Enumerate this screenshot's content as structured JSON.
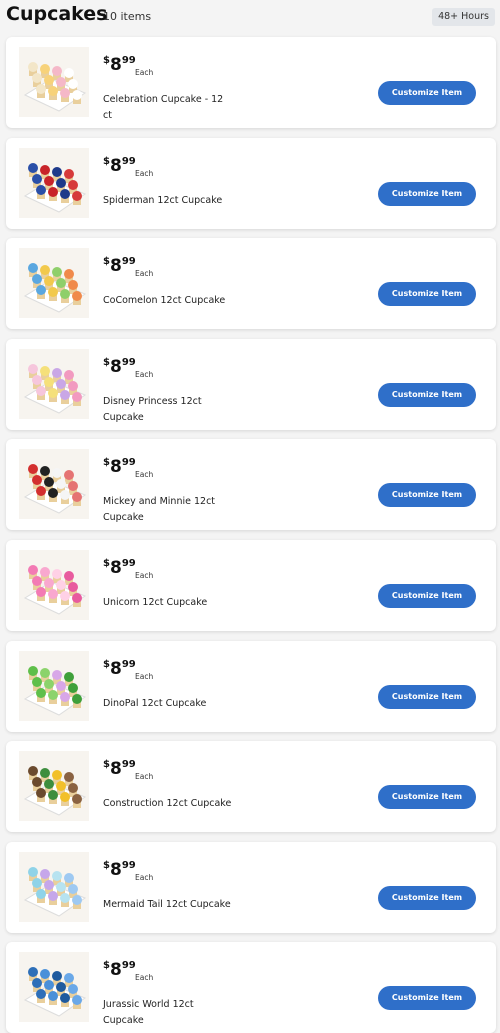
{
  "header": {
    "title": "Cupcakes",
    "count": "10 items",
    "badge": "48+ Hours"
  },
  "items": [
    {
      "name": "Celebration Cupcake - 12 ct",
      "currency": "$",
      "dollars": "8",
      "cents": "99",
      "unit": "Each",
      "button": "Customize Item",
      "colors": [
        "#f3e6c8",
        "#f7d27a",
        "#f5b8c8",
        "#ffffff"
      ]
    },
    {
      "name": "Spiderman 12ct Cupcake",
      "currency": "$",
      "dollars": "8",
      "cents": "99",
      "unit": "Each",
      "button": "Customize Item",
      "colors": [
        "#2a4fa8",
        "#c8242a",
        "#1e3a8a",
        "#d63a3a"
      ]
    },
    {
      "name": "CoComelon 12ct Cupcake",
      "currency": "$",
      "dollars": "8",
      "cents": "99",
      "unit": "Each",
      "button": "Customize Item",
      "colors": [
        "#5aa7e0",
        "#f2c94c",
        "#8fcf6a",
        "#f08a4b"
      ]
    },
    {
      "name": "Disney Princess 12ct Cupcake",
      "currency": "$",
      "dollars": "8",
      "cents": "99",
      "unit": "Each",
      "button": "Customize Item",
      "colors": [
        "#f6c6dc",
        "#f5e07a",
        "#c9a7e6",
        "#f29ac0"
      ]
    },
    {
      "name": "Mickey and Minnie 12ct Cupcake",
      "currency": "$",
      "dollars": "8",
      "cents": "99",
      "unit": "Each",
      "button": "Customize Item",
      "colors": [
        "#d32f2f",
        "#222222",
        "#f5f5f5",
        "#e57373"
      ]
    },
    {
      "name": "Unicorn 12ct Cupcake",
      "currency": "$",
      "dollars": "8",
      "cents": "99",
      "unit": "Each",
      "button": "Customize Item",
      "colors": [
        "#f37ab4",
        "#f9a8cf",
        "#ffd1e6",
        "#e85a9e"
      ]
    },
    {
      "name": "DinoPal 12ct Cupcake",
      "currency": "$",
      "dollars": "8",
      "cents": "99",
      "unit": "Each",
      "button": "Customize Item",
      "colors": [
        "#5fbf4a",
        "#8cd36b",
        "#d8a7e8",
        "#3fa03a"
      ]
    },
    {
      "name": "Construction 12ct Cupcake",
      "currency": "$",
      "dollars": "8",
      "cents": "99",
      "unit": "Each",
      "button": "Customize Item",
      "colors": [
        "#6b4a2e",
        "#3e8e3e",
        "#f2c02a",
        "#8a6242"
      ]
    },
    {
      "name": "Mermaid Tail 12ct Cupcake",
      "currency": "$",
      "dollars": "8",
      "cents": "99",
      "unit": "Each",
      "button": "Customize Item",
      "colors": [
        "#8fd3e8",
        "#c6a7ea",
        "#b7e3f0",
        "#9ec9f2"
      ]
    },
    {
      "name": "Jurassic World 12ct Cupcake",
      "currency": "$",
      "dollars": "8",
      "cents": "99",
      "unit": "Each",
      "button": "Customize Item",
      "colors": [
        "#2e6fb8",
        "#4a90d9",
        "#1f5a9e",
        "#6aa8e8"
      ]
    }
  ]
}
